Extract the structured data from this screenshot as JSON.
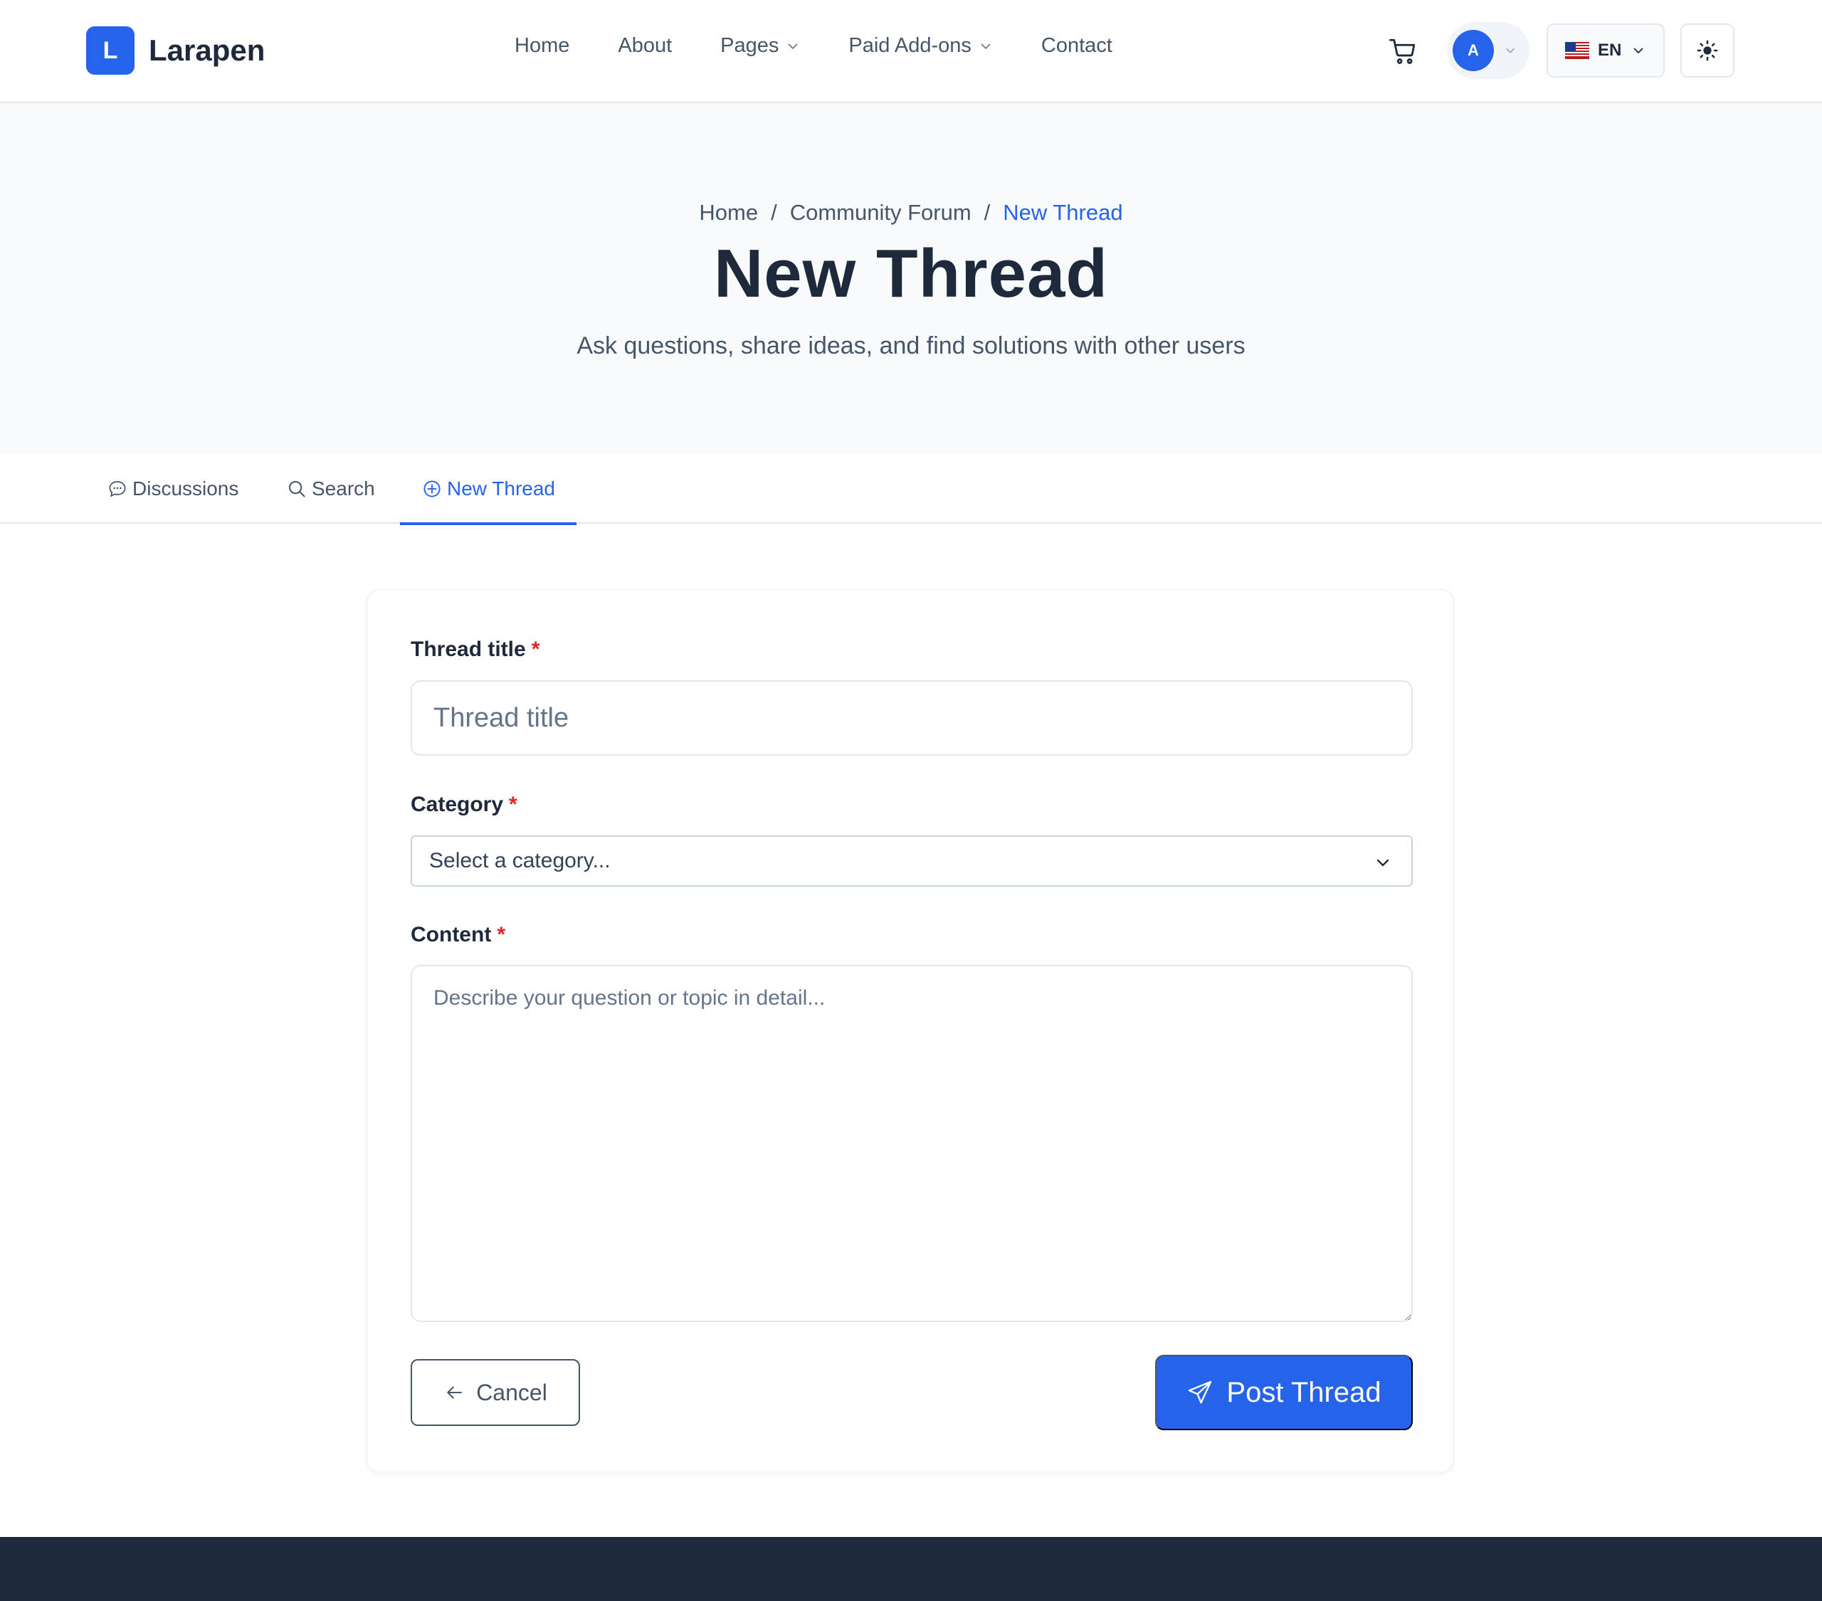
{
  "brand": {
    "logo_letter": "L",
    "name": "Larapen"
  },
  "nav": {
    "items": [
      {
        "label": "Home"
      },
      {
        "label": "About"
      },
      {
        "label": "Pages"
      },
      {
        "label": "Paid Add-ons"
      },
      {
        "label": "Contact"
      }
    ]
  },
  "user": {
    "avatar_initial": "A"
  },
  "language": {
    "code": "EN",
    "flag_icon": "us-flag-icon"
  },
  "theme_toggle": {
    "icon": "sun-icon"
  },
  "hero": {
    "breadcrumb": [
      "Home",
      "Community Forum",
      "New Thread"
    ],
    "breadcrumb_separator": "/",
    "title": "New Thread",
    "subtitle": "Ask questions, share ideas, and find solutions with other users"
  },
  "tabs": [
    {
      "label": "Discussions",
      "icon": "chat-bubble-icon",
      "active": false
    },
    {
      "label": "Search",
      "icon": "search-icon",
      "active": false
    },
    {
      "label": "New Thread",
      "icon": "plus-circle-icon",
      "active": true
    }
  ],
  "form": {
    "title_label": "Thread title",
    "title_placeholder": "Thread title",
    "title_value": "",
    "category_label": "Category",
    "category_selected": "Select a category...",
    "content_label": "Content",
    "content_placeholder": "Describe your question or topic in detail...",
    "content_value": "",
    "required_marker": "*",
    "cancel_label": "Cancel",
    "submit_label": "Post Thread"
  },
  "colors": {
    "accent": "#2563eb",
    "text_dark": "#1e293b",
    "text_muted": "#475569",
    "required": "#dc2626",
    "hero_bg": "#f8fafc",
    "footer_bg": "#1e293b"
  }
}
